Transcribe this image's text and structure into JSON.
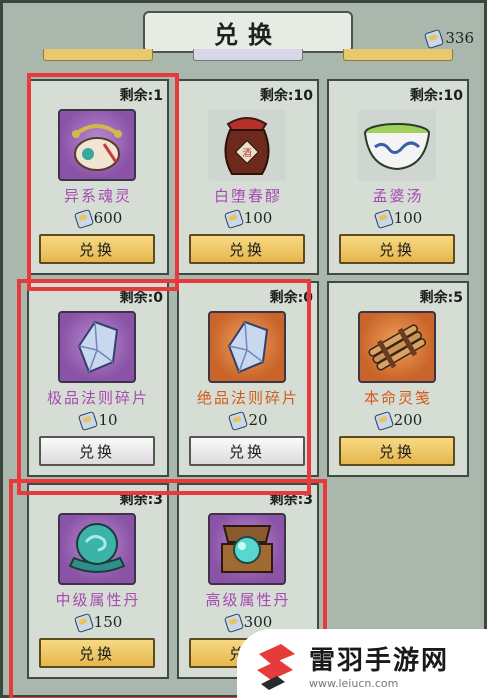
{
  "header": {
    "title": "兑换",
    "currency_icon": "scroll-token-icon",
    "currency_amount": "336"
  },
  "items": [
    {
      "stock": "剩余:1",
      "name": "异系魂灵",
      "price": "600",
      "button": "兑换",
      "icon": "purse-icon",
      "rarity": "purple"
    },
    {
      "stock": "剩余:10",
      "name": "白堕春醪",
      "price": "100",
      "button": "兑换",
      "icon": "wine-jar-icon",
      "rarity": "none"
    },
    {
      "stock": "剩余:10",
      "name": "孟婆汤",
      "price": "100",
      "button": "兑换",
      "icon": "soup-bowl-icon",
      "rarity": "none"
    },
    {
      "stock": "剩余:0",
      "name": "极品法则碎片",
      "price": "10",
      "button": "兑换",
      "icon": "crystal-shard-icon",
      "rarity": "purple",
      "disabled": true
    },
    {
      "stock": "剩余:0",
      "name": "绝品法则碎片",
      "price": "20",
      "button": "兑换",
      "icon": "crystal-shard-icon",
      "rarity": "orange",
      "disabled": true
    },
    {
      "stock": "剩余:5",
      "name": "本命灵笺",
      "price": "200",
      "button": "兑换",
      "icon": "bamboo-slips-icon",
      "rarity": "orange"
    },
    {
      "stock": "剩余:3",
      "name": "中级属性丹",
      "price": "150",
      "button": "兑换",
      "icon": "jade-orb-icon",
      "rarity": "purple"
    },
    {
      "stock": "剩余:3",
      "name": "高级属性丹",
      "price": "300",
      "button": "兑换",
      "icon": "orb-box-icon",
      "rarity": "purple"
    }
  ],
  "watermark": {
    "name": "雷羽手游网",
    "url": "www.leiucn.com"
  },
  "colors": {
    "highlight": "#e8393c",
    "purple_name": "#a64bb0",
    "orange_name": "#d35a19",
    "button_gold": "#e5b74d"
  }
}
